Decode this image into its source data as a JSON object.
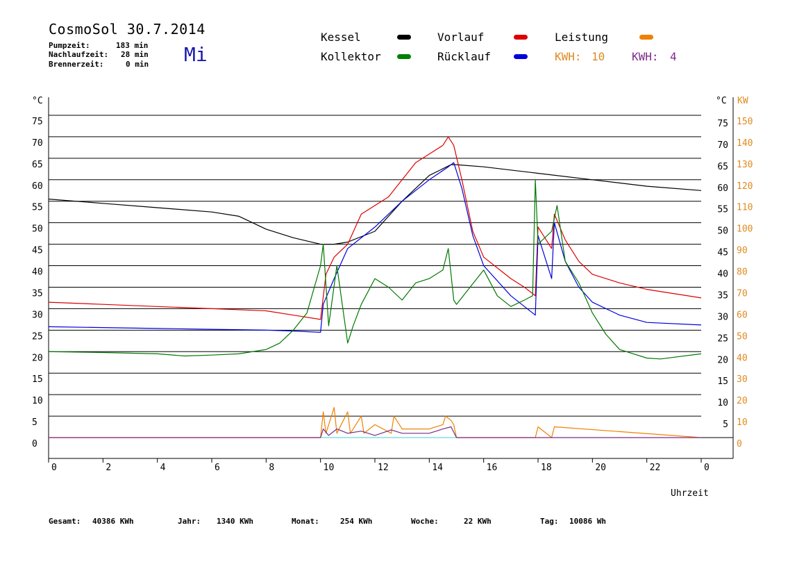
{
  "header": {
    "title": "CosmoSol 30.7.2014",
    "weekday": "Mi",
    "stats": [
      {
        "label": "Pumpzeit:",
        "value": "183 min"
      },
      {
        "label": "Nachlaufzeit:",
        "value": "28 min"
      },
      {
        "label": "Brennerzeit:",
        "value": "0 min"
      }
    ]
  },
  "legend": [
    {
      "name": "Kessel",
      "color": "#000000"
    },
    {
      "name": "Vorlauf",
      "color": "#dd0000"
    },
    {
      "name": "Leistung",
      "color": "#f08000"
    },
    {
      "name": "Kollektor",
      "color": "#008000"
    },
    {
      "name": "Rücklauf",
      "color": "#0000dd"
    }
  ],
  "kwh": [
    {
      "label": "KWH:",
      "value": "10",
      "color": "#e08a1e"
    },
    {
      "label": "KWH:",
      "value": "4",
      "color": "#7a2a8a"
    }
  ],
  "footer": [
    {
      "label": "Gesamt:",
      "value": "40386 KWh"
    },
    {
      "label": "Jahr:",
      "value": "1340 KWh"
    },
    {
      "label": "Monat:",
      "value": "254 KWh"
    },
    {
      "label": "Woche:",
      "value": "22 KWh"
    },
    {
      "label": "Tag:",
      "value": "10086 Wh"
    }
  ],
  "colors": {
    "kessel": "#000000",
    "vorlauf": "#dd0000",
    "ruecklauf": "#0000dd",
    "kollektor": "#007800",
    "leistung": "#f08000",
    "kwh2": "#7a2a8a",
    "zero_line": "#40d0d0",
    "kw_axis": "#e08a1e"
  },
  "chart_data": {
    "type": "line",
    "xlabel": "Uhrzeit",
    "ylabel_left": "°C",
    "ylabel_right_temp": "°C",
    "ylabel_right_power": "KW",
    "xlim": [
      0,
      24
    ],
    "ylim": [
      0,
      75
    ],
    "y2lim": [
      0,
      150
    ],
    "x_ticks": [
      "0",
      "2",
      "4",
      "6",
      "8",
      "10",
      "12",
      "14",
      "16",
      "18",
      "20",
      "22",
      "0"
    ],
    "y_ticks": [
      "0",
      "5",
      "10",
      "15",
      "20",
      "25",
      "30",
      "35",
      "40",
      "45",
      "50",
      "55",
      "60",
      "65",
      "70",
      "75"
    ],
    "y_ticks_right": [
      "5",
      "10",
      "15",
      "20",
      "25",
      "30",
      "35",
      "40",
      "45",
      "50",
      "55",
      "60",
      "65",
      "70",
      "75"
    ],
    "y2_ticks": [
      "0",
      "10",
      "20",
      "30",
      "40",
      "50",
      "60",
      "70",
      "80",
      "90",
      "100",
      "110",
      "120",
      "130",
      "140",
      "150"
    ],
    "grid": "horizontal",
    "series": [
      {
        "name": "Kessel",
        "x": [
          0,
          2,
          4,
          6,
          7,
          7.5,
          8,
          9,
          10,
          10.5,
          11,
          12,
          13,
          14,
          14.8,
          15,
          16,
          18,
          20,
          22,
          24
        ],
        "y": [
          55.5,
          54.5,
          53.5,
          52.5,
          51.5,
          50,
          48.5,
          46.5,
          45,
          45,
          45.5,
          48,
          55,
          61,
          63.5,
          63.5,
          63,
          61.5,
          60,
          58.5,
          57.5
        ]
      },
      {
        "name": "Vorlauf",
        "x": [
          0,
          2,
          4,
          6,
          8,
          9,
          10,
          10.2,
          10.5,
          11,
          11.5,
          12,
          12.5,
          13,
          13.5,
          14,
          14.5,
          14.7,
          14.9,
          15.2,
          15.6,
          16,
          17,
          17.5,
          17.9,
          18,
          18.5,
          18.6,
          19,
          19.5,
          20,
          21,
          22,
          24
        ],
        "y": [
          31.5,
          31,
          30.5,
          30,
          29.5,
          28.5,
          27.5,
          38,
          42,
          45,
          52,
          54,
          56,
          60,
          64,
          66,
          68,
          70,
          68,
          60,
          48,
          42,
          37,
          35,
          33,
          49,
          44,
          52,
          46,
          41,
          38,
          36,
          34.5,
          32.5
        ]
      },
      {
        "name": "Rücklauf",
        "x": [
          0,
          2,
          4,
          6,
          8,
          9,
          10,
          10.1,
          10.5,
          11,
          12,
          13,
          14,
          14.7,
          14.9,
          15.2,
          15.6,
          16,
          17,
          17.5,
          17.9,
          18,
          18.5,
          18.6,
          19,
          19.5,
          20,
          21,
          22,
          24
        ],
        "y": [
          25.8,
          25.6,
          25.4,
          25.2,
          25,
          24.8,
          24.5,
          31,
          37,
          44,
          49,
          55,
          60,
          63,
          64,
          58,
          47,
          40,
          33,
          30.5,
          28.5,
          47,
          37,
          50,
          41,
          35,
          31.5,
          28.5,
          26.8,
          26.2
        ]
      },
      {
        "name": "Kollektor",
        "x": [
          0,
          2,
          4,
          5,
          6,
          7,
          8,
          8.5,
          9,
          9.5,
          10,
          10.1,
          10.3,
          10.6,
          11,
          11.2,
          11.5,
          12,
          12.5,
          13,
          13.5,
          14,
          14.5,
          14.7,
          14.9,
          15,
          15.5,
          16,
          16.5,
          17,
          17.5,
          17.8,
          17.9,
          18,
          18.5,
          18.7,
          19,
          19.5,
          20,
          20.5,
          21,
          22,
          22.5,
          24
        ],
        "y": [
          20,
          19.8,
          19.5,
          19,
          19.2,
          19.5,
          20.5,
          22,
          25,
          29,
          40,
          45,
          26,
          40,
          22,
          26,
          31,
          37,
          35,
          32,
          36,
          37,
          39,
          44,
          32,
          31,
          35,
          39,
          33,
          30.5,
          32,
          33,
          60,
          45,
          48,
          54,
          41,
          36,
          29,
          24,
          20.5,
          18.5,
          18.3,
          19.5
        ]
      },
      {
        "name": "Leistung",
        "x": [
          0,
          10,
          10.1,
          10.2,
          10.5,
          10.6,
          11,
          11.1,
          11.5,
          11.6,
          12,
          12.6,
          12.7,
          13,
          14,
          14.5,
          14.6,
          14.8,
          14.9,
          15,
          17.9,
          18,
          18.5,
          18.6,
          24
        ],
        "y": [
          0,
          0,
          6,
          1,
          7,
          1,
          6,
          1,
          5,
          1,
          3,
          1,
          5,
          2,
          2,
          3,
          5,
          4,
          3,
          0,
          0,
          2.5,
          0,
          2.5,
          0
        ]
      },
      {
        "name": "KWH",
        "x": [
          0,
          10,
          10.1,
          10.3,
          10.6,
          11,
          11.5,
          12,
          12.6,
          13,
          14,
          14.5,
          14.8,
          15,
          24
        ],
        "y": [
          0,
          0,
          2,
          0.5,
          2,
          1,
          1.5,
          0.5,
          1.8,
          1,
          1,
          2,
          2.5,
          0,
          0
        ]
      }
    ]
  }
}
